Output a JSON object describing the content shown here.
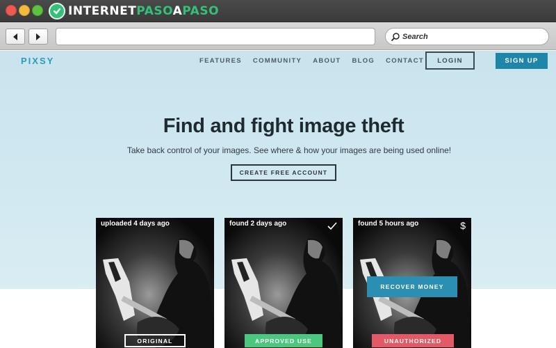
{
  "browser": {
    "brand": {
      "part1": "INTERNET",
      "part2": "PASO",
      "part3": "A",
      "part4": "PASO"
    },
    "search_placeholder": "Search",
    "icons": {
      "back": "arrow-left-icon",
      "forward": "arrow-right-icon",
      "search": "magnifier-icon"
    }
  },
  "site": {
    "logo": "PIXSY",
    "nav": [
      "FEATURES",
      "COMMUNITY",
      "ABOUT",
      "BLOG",
      "CONTACT"
    ],
    "login": "LOGIN",
    "signup": "SIGN UP",
    "hero": {
      "title": "Find and fight image theft",
      "subtitle": "Take back control of your images. See where & how your images are being used online!",
      "cta": "CREATE FREE ACCOUNT"
    },
    "cards": [
      {
        "caption": "uploaded 4 days ago",
        "tag": "ORIGINAL",
        "icon": ""
      },
      {
        "caption": "found 2 days ago",
        "tag": "APPROVED USE",
        "icon": "checkmark-icon"
      },
      {
        "caption": "found 5 hours ago",
        "tag": "UNAUTHORIZED",
        "icon": "dollar-icon",
        "icon_char": "$",
        "action": "RECOVER MONEY"
      }
    ]
  },
  "colors": {
    "accent": "#1d86a9",
    "approved": "#4cc77f",
    "unauthorized": "#e35a66",
    "recover": "#2b8fb3",
    "brand_green": "#35c07a"
  }
}
